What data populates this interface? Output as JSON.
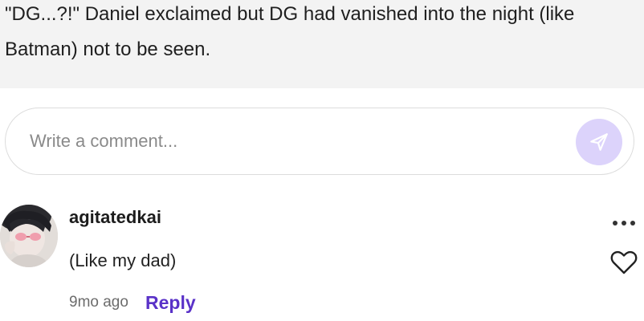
{
  "story": {
    "text": "\"DG...?!\" Daniel exclaimed but DG had vanished into the night (like Batman) not to be seen."
  },
  "comment_input": {
    "placeholder": "Write a comment...",
    "value": ""
  },
  "icons": {
    "send": "send-icon",
    "more": "more-options-icon",
    "like": "heart-outline-icon"
  },
  "comment": {
    "username": "agitatedkai",
    "text": "(Like my dad)",
    "timestamp": "9mo ago",
    "reply_label": "Reply"
  },
  "colors": {
    "accent": "#5a32c8",
    "send_button_bg": "#dcd3fb",
    "story_bg": "#f3f3f3"
  }
}
